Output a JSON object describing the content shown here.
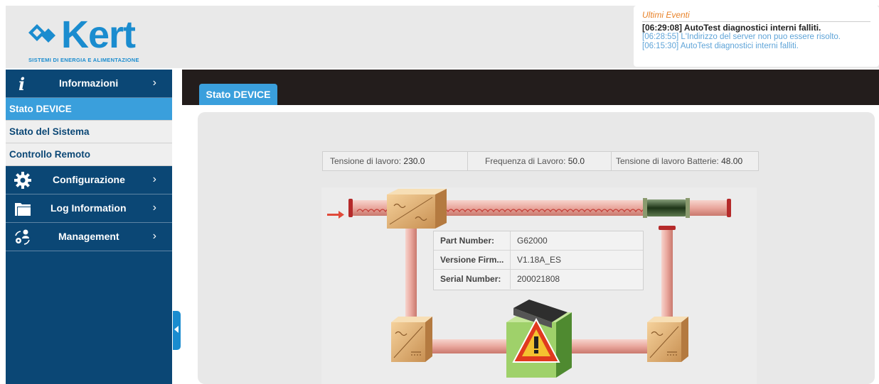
{
  "brand": {
    "name": "Kert",
    "tagline": "SISTEMI DI ENERGIA E ALIMENTAZIONE",
    "color": "#1a8ccf"
  },
  "events": {
    "title": "Ultimi Eventi",
    "items": [
      "[06:29:08] AutoTest diagnostici interni falliti.",
      "[06:28:55] L'Indirizzo del server non puo essere risolto.",
      "[06:15:30] AutoTest diagnostici interni falliti."
    ]
  },
  "sidebar": {
    "menus": [
      {
        "label": "Informazioni",
        "icon": "info-icon",
        "chevron": "›"
      },
      {
        "label": "Configurazione",
        "icon": "gear-icon",
        "chevron": "›"
      },
      {
        "label": "Log Information",
        "icon": "folder-icon",
        "chevron": "›"
      },
      {
        "label": "Management",
        "icon": "user-management-icon",
        "chevron": "›"
      }
    ],
    "submenu": [
      {
        "label": "Stato DEVICE",
        "active": true
      },
      {
        "label": "Stato del Sistema",
        "active": false
      },
      {
        "label": "Controllo Remoto",
        "active": false
      }
    ]
  },
  "main": {
    "tab": "Stato DEVICE",
    "readings": [
      {
        "label": "Tensione di lavoro:",
        "value": "230.0"
      },
      {
        "label": "Frequenza di Lavoro:",
        "value": "50.0"
      },
      {
        "label": "Tensione di lavoro Batterie:",
        "value": "48.00"
      }
    ],
    "device_info": [
      {
        "label": "Part Number:",
        "value": "G62000"
      },
      {
        "label": "Versione Firm...",
        "value": "V1.18A_ES"
      },
      {
        "label": "Serial Number:",
        "value": "200021808"
      }
    ],
    "status": "warning"
  },
  "colors": {
    "sidebar": "#0b4775",
    "accent": "#3a9fdc",
    "topbar": "#231d1c",
    "pipe": "#e9a79d",
    "warning": "#e03a1e"
  }
}
